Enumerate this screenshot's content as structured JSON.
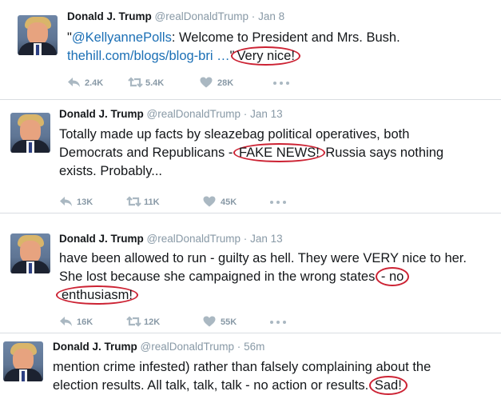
{
  "tweets": [
    {
      "name": "Donald J. Trump",
      "handle": "@realDonaldTrump",
      "dot": "·",
      "time": "Jan 8",
      "line1": {
        "quote": "\"",
        "mention": "@KellyannePolls",
        "rest": ": Welcome to President and Mrs. Bush."
      },
      "line2": {
        "link": "thehill.com/blogs/blog-bri …",
        "mid": "\"",
        "circled": "Very nice!"
      },
      "reply_count": "2.4K",
      "retweet_count": "5.4K",
      "like_count": "28K"
    },
    {
      "name": "Donald J. Trump",
      "handle": "@realDonaldTrump",
      "dot": "·",
      "time": "Jan 13",
      "line1": "Totally made up facts by sleazebag political operatives, both",
      "line2": {
        "pre": "Democrats and Republicans - ",
        "circled": "FAKE NEWS!",
        "post": " Russia says nothing"
      },
      "line3": "exists. Probably...",
      "reply_count": "13K",
      "retweet_count": "11K",
      "like_count": "45K"
    },
    {
      "name": "Donald J. Trump",
      "handle": "@realDonaldTrump",
      "dot": "·",
      "time": "Jan 13",
      "line1": "have been allowed to run - guilty as hell. They were VERY nice to her.",
      "line2": {
        "pre": "She lost because she campaigned in the wrong states ",
        "circled": "- no"
      },
      "line3": {
        "circled": "enthusiasm!"
      },
      "reply_count": "16K",
      "retweet_count": "12K",
      "like_count": "55K"
    },
    {
      "name": "Donald J. Trump",
      "handle": "@realDonaldTrump",
      "dot": "·",
      "time": "56m",
      "line1": "mention crime infested) rather than falsely complaining about the",
      "line2": {
        "pre": "election results. All talk, talk, talk - no action or results. ",
        "circled": "Sad!"
      }
    }
  ],
  "icons": {
    "reply": "reply-icon",
    "retweet": "retweet-icon",
    "like": "heart-icon",
    "more": "more-icon"
  },
  "colors": {
    "link": "#1b6fb5",
    "meta": "#8899a6",
    "highlight": "#cc2233"
  }
}
